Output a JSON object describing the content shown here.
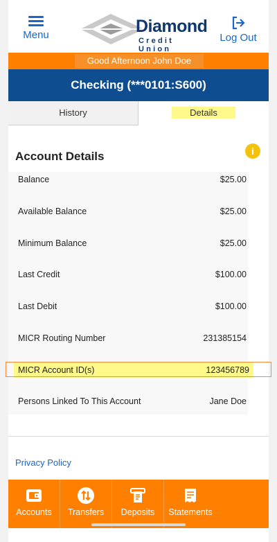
{
  "header": {
    "menu_label": "Menu",
    "logout_label": "Log Out",
    "logo_name": "Diamond",
    "logo_sub": "Credit Union"
  },
  "greeting": "Good Afternoon John Doe",
  "account_title": "Checking  (***0101:S600)",
  "tabs": [
    {
      "label": "History",
      "active": false
    },
    {
      "label": "Details",
      "active": true
    }
  ],
  "section_title": "Account Details",
  "details": [
    {
      "label": "Balance",
      "value": "$25.00"
    },
    {
      "label": "Available Balance",
      "value": "$25.00"
    },
    {
      "label": "Minimum Balance",
      "value": "$25.00"
    },
    {
      "label": "Last Credit",
      "value": "$100.00"
    },
    {
      "label": "Last Debit",
      "value": "$100.00"
    },
    {
      "label": "MICR Routing Number",
      "value": "231385154"
    },
    {
      "label": "MICR Account ID(s)",
      "value": "123456789",
      "highlighted": true
    },
    {
      "label": "Persons Linked To This Account",
      "value": "Jane Doe"
    }
  ],
  "privacy_label": "Privacy Policy",
  "bottom_nav": [
    {
      "label": "Accounts",
      "icon": "wallet-icon"
    },
    {
      "label": "Transfers",
      "icon": "transfer-icon"
    },
    {
      "label": "Deposits",
      "icon": "deposit-check-icon"
    },
    {
      "label": "Statements",
      "icon": "statement-icon"
    }
  ],
  "colors": {
    "brand_orange": "#ff7f00",
    "brand_navy": "#0e4d8f",
    "link_blue": "#1a67c7",
    "highlight_yellow": "#fff98a"
  }
}
